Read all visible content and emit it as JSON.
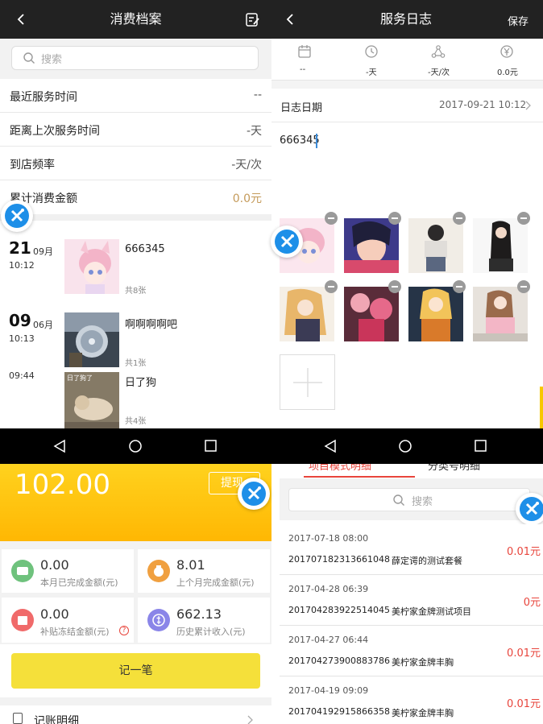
{
  "panel1": {
    "title": "消费档案",
    "search_placeholder": "搜索",
    "rows": [
      {
        "label": "最近服务时间",
        "value": "--"
      },
      {
        "label": "距离上次服务时间",
        "value": "-天"
      },
      {
        "label": "到店频率",
        "value": "-天/次"
      },
      {
        "label": "累计消费金额",
        "value": "0.0元"
      }
    ],
    "timeline": [
      {
        "day": "21",
        "month": "09月",
        "time": "10:12",
        "title": "666345",
        "count": "共8张"
      },
      {
        "day": "09",
        "month": "06月",
        "time": "10:13",
        "title": "啊啊啊啊吧",
        "count": "共1张"
      },
      {
        "day": "",
        "month": "",
        "time": "09:44",
        "title": "日了狗",
        "count": "共4张"
      }
    ],
    "dog_caption": "日了狗了"
  },
  "panel2": {
    "title": "服务日志",
    "save_label": "保存",
    "stats": [
      {
        "icon": "calendar-icon",
        "value": "--"
      },
      {
        "icon": "clock-icon",
        "value": "-天"
      },
      {
        "icon": "share-icon",
        "value": "-天/次"
      },
      {
        "icon": "yen-icon",
        "value": "0.0元"
      }
    ],
    "date_label": "日志日期",
    "date_value": "2017-09-21 10:12",
    "content": "666345"
  },
  "panel3": {
    "balance": "102.00",
    "withdraw_label": "提现",
    "stats": [
      {
        "value": "0.00",
        "label": "本月已完成金额(元)",
        "color": "#6fc27d"
      },
      {
        "value": "8.01",
        "label": "上个月完成金额(元)",
        "color": "#f0a040"
      },
      {
        "value": "0.00",
        "label": "补贴冻结金额(元)",
        "color": "#f06a6a"
      },
      {
        "value": "662.13",
        "label": "历史累计收入(元)",
        "color": "#8a85e8"
      }
    ],
    "record_button": "记一笔",
    "ledger_label": "记账明细"
  },
  "panel4": {
    "tabs": [
      "项目模式明细",
      "分类号明细"
    ],
    "search_placeholder": "搜索",
    "orders": [
      {
        "time": "2017-07-18 08:00",
        "order_no": "20170718231366104​8",
        "name": "薛定谔的测试套餐",
        "amount": "0.01元"
      },
      {
        "time": "2017-04-28 06:39",
        "order_no": "201704283922514045",
        "name": "美柠家金牌测试项目",
        "amount": "0元"
      },
      {
        "time": "2017-04-27 06:44",
        "order_no": "201704273900883786",
        "name": "美柠家金牌丰胸",
        "amount": "0.01元"
      },
      {
        "time": "2017-04-19 09:09",
        "order_no": "201704192915866358",
        "name": "美柠家金牌丰胸",
        "amount": "0.01元"
      }
    ]
  },
  "colors": {
    "accent_orange": "#c49a5a",
    "amount_red": "#e8453c",
    "yellow_top": "#ffd21e",
    "yellow_bottom": "#ffb703",
    "button_yellow": "#f5e03a",
    "float_blue": "#1e8fe8"
  }
}
